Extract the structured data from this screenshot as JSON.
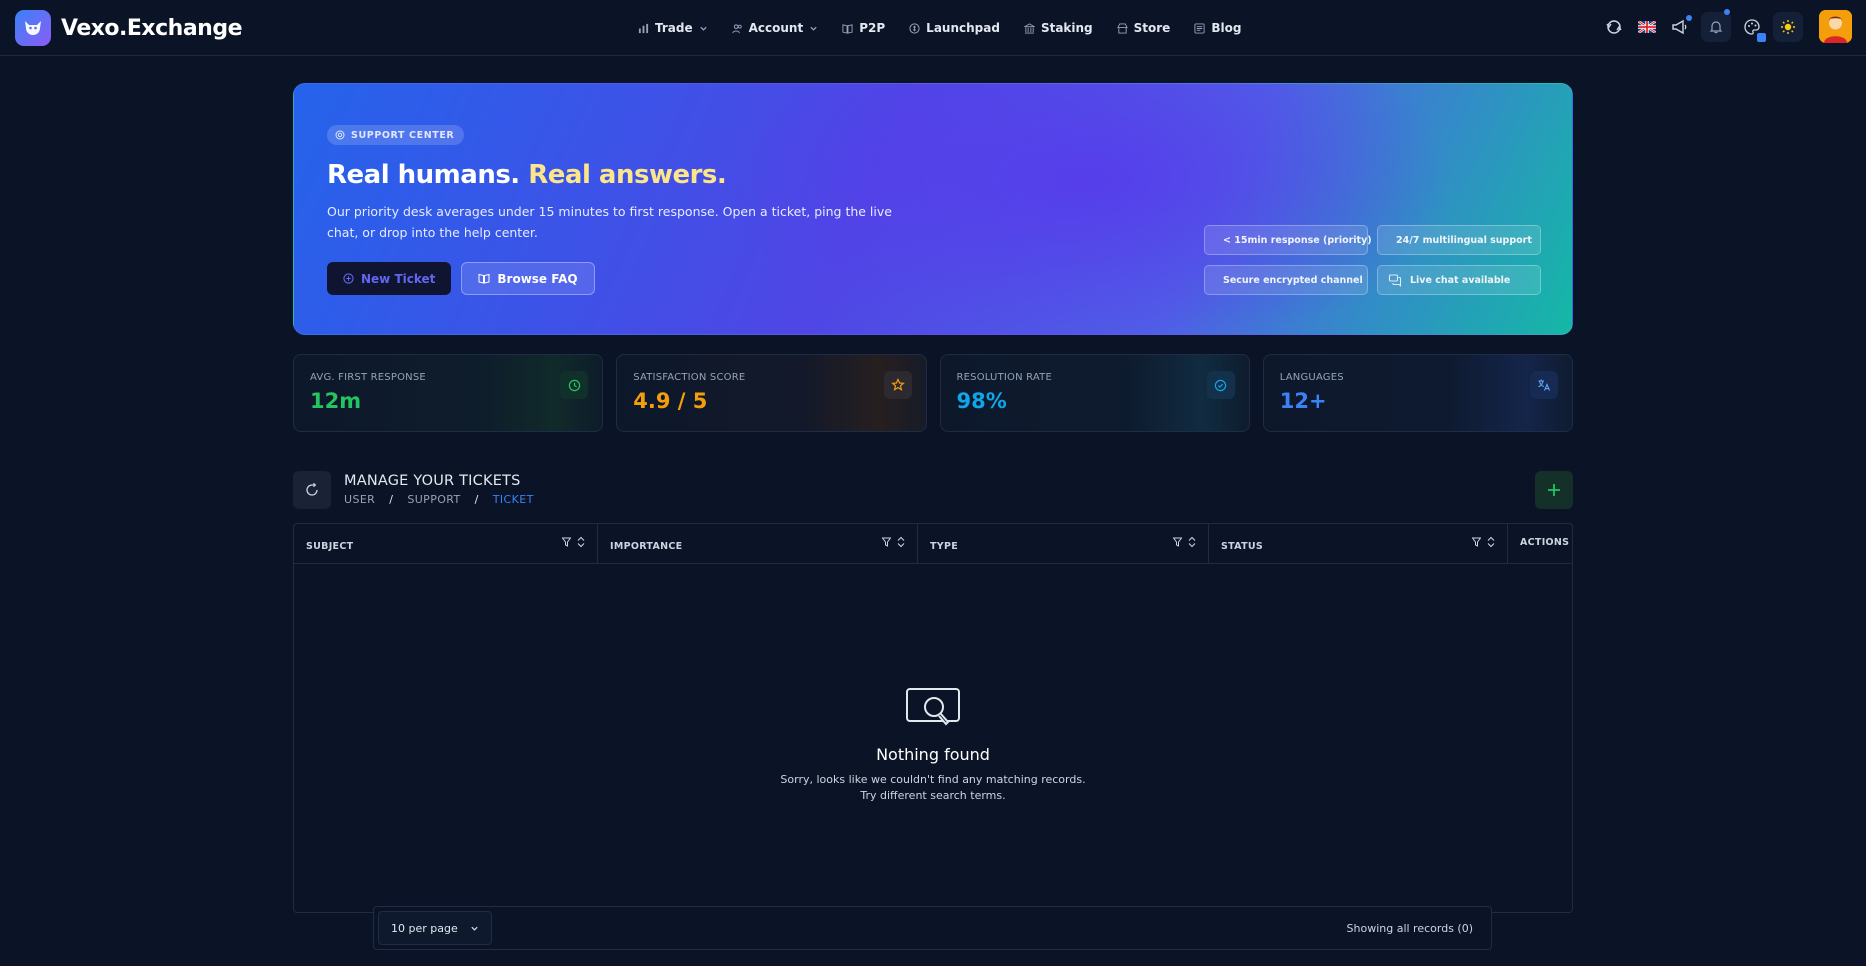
{
  "brand": {
    "name": "Vexo.Exchange"
  },
  "nav": {
    "items": [
      {
        "label": "Trade",
        "icon": "chart-bar-icon",
        "dropdown": true
      },
      {
        "label": "Account",
        "icon": "users-icon",
        "dropdown": true
      },
      {
        "label": "P2P",
        "icon": "book-icon",
        "dropdown": false
      },
      {
        "label": "Launchpad",
        "icon": "coin-icon",
        "dropdown": false
      },
      {
        "label": "Staking",
        "icon": "bank-icon",
        "dropdown": false
      },
      {
        "label": "Store",
        "icon": "store-icon",
        "dropdown": false
      },
      {
        "label": "Blog",
        "icon": "newspaper-icon",
        "dropdown": false
      }
    ]
  },
  "hero": {
    "badge": "SUPPORT CENTER",
    "title_part1": "Real humans.",
    "title_part2": "Real answers.",
    "subtitle": "Our priority desk averages under 15 minutes to first response. Open a ticket, ping the live chat, or drop into the help center.",
    "primary_button": "New Ticket",
    "secondary_button": "Browse FAQ",
    "features": [
      {
        "label": "< 15min response (priority)",
        "icon": "clock-icon"
      },
      {
        "label": "24/7 multilingual support",
        "icon": "globe-icon"
      },
      {
        "label": "Secure encrypted channel",
        "icon": "shield-check-icon"
      },
      {
        "label": "Live chat available",
        "icon": "chat-icon"
      }
    ]
  },
  "stats": [
    {
      "label": "AVG. FIRST RESPONSE",
      "value": "12m",
      "color": "#22c55e",
      "icon": "clock-icon"
    },
    {
      "label": "SATISFACTION SCORE",
      "value": "4.9 / 5",
      "color": "#f59e0b",
      "icon": "star-icon"
    },
    {
      "label": "RESOLUTION RATE",
      "value": "98%",
      "color": "#0ea5e9",
      "icon": "check-circle-icon"
    },
    {
      "label": "LANGUAGES",
      "value": "12+",
      "color": "#3b82f6",
      "icon": "translate-icon"
    }
  ],
  "section": {
    "title": "MANAGE YOUR TICKETS",
    "breadcrumb": [
      "USER",
      "/",
      "SUPPORT",
      "/",
      "TICKET"
    ]
  },
  "table": {
    "columns": [
      "SUBJECT",
      "IMPORTANCE",
      "TYPE",
      "STATUS",
      "ACTIONS"
    ],
    "empty_title": "Nothing found",
    "empty_line1": "Sorry, looks like we couldn't find any matching records.",
    "empty_line2": "Try different search terms."
  },
  "pagination": {
    "per_page": "10 per page",
    "showing": "Showing all records (0)"
  },
  "colors": {
    "background": "#0b1426",
    "accent_blue": "#3b82f6",
    "accent_green": "#22c55e",
    "hero_title_accent": "#fde68a"
  }
}
